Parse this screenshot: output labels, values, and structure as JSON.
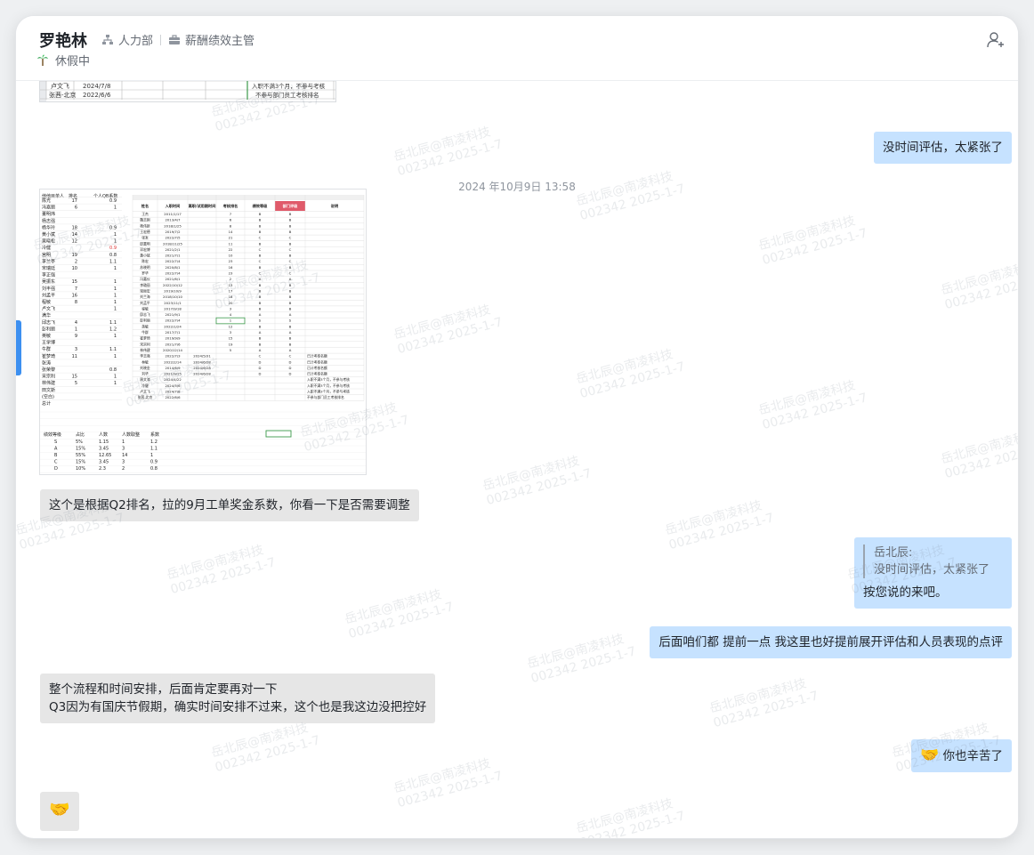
{
  "header": {
    "name": "罗艳林",
    "department": "人力部",
    "title": "薪酬绩效主管",
    "status": "休假中"
  },
  "icons": {
    "department": "org-chart-icon",
    "title": "briefcase-icon",
    "status": "palm-tree-icon",
    "add_user": "add-user-icon"
  },
  "top_snippet": {
    "rows": [
      {
        "name": "卢文飞",
        "date": "2024/7/8",
        "note": "入职不满3个月，不参与考核"
      },
      {
        "name": "张茜-北京",
        "date": "2022/6/6",
        "note": "不参与部门员工考核排名"
      }
    ]
  },
  "messages": {
    "m1": "没时间评估，太紧张了",
    "timestamp": "2024 年10月9日 13:58",
    "m2": "这个是根据Q2排名，拉的9月工单奖金系数，你看一下是否需要调整",
    "reply_quote_author": "岳北辰:",
    "reply_quote_text": "没时间评估，太紧张了",
    "reply_text": "按您说的来吧。",
    "m4": "后面咱们都  提前一点 我这里也好提前展开评估和人员表现的点评",
    "m5_line1": "整个流程和时间安排，后面肯定要再对一下",
    "m5_line2": "Q3因为有国庆节假期，确实时间安排不过来，这个也是我这边没把控好",
    "m6_emoji": "🤝",
    "m6_text": "你也辛苦了",
    "m7_emoji": "🤝"
  },
  "sheet": {
    "left_headers": [
      "他他目单人",
      "排名",
      "个人QB系数"
    ],
    "left_rows": [
      [
        "陈光",
        "17",
        "0.9"
      ],
      [
        "冯嘉丽",
        "6",
        "1"
      ],
      [
        "董明炜",
        "",
        ""
      ],
      [
        "杨志强",
        "",
        ""
      ],
      [
        "杨华玲",
        "18",
        "0.9"
      ],
      [
        "黄小斌",
        "14",
        "1"
      ],
      [
        "吴晓松",
        "12",
        "1"
      ],
      [
        "冷健",
        "",
        "0.9"
      ],
      [
        "宫明",
        "19",
        "0.8"
      ],
      [
        "李兰亭",
        "2",
        "1.1"
      ],
      [
        "宋瑞廷",
        "10",
        "1"
      ],
      [
        "李正强",
        "",
        ""
      ],
      [
        "吴振东",
        "15",
        "1"
      ],
      [
        "刘丰强",
        "7",
        "1"
      ],
      [
        "刘孟平",
        "16",
        "1"
      ],
      [
        "程敏",
        "8",
        "1"
      ],
      [
        "卢文飞",
        "",
        "1"
      ],
      [
        "满华",
        "",
        ""
      ],
      [
        "邱志飞",
        "4",
        "1.1"
      ],
      [
        "彭利丽",
        "1",
        "1.2"
      ],
      [
        "英敏",
        "9",
        "1"
      ],
      [
        "王学博",
        "",
        ""
      ],
      [
        "牛群",
        "3",
        "1.1"
      ],
      [
        "崔梦琦",
        "11",
        "1"
      ],
      [
        "张涛",
        "",
        ""
      ],
      [
        "张荣黎",
        "",
        "0.8"
      ],
      [
        "宋宗利",
        "15",
        "1"
      ],
      [
        "林伟建",
        "5",
        "1"
      ],
      [
        "田文斯",
        "",
        ""
      ],
      [
        "(空白)",
        "",
        ""
      ],
      [
        "总计",
        "",
        ""
      ]
    ],
    "right_headers": [
      "姓名",
      "入职时间",
      "离职/试用期时间",
      "考核排名",
      "绩效等级",
      "部门评级",
      "说明"
    ],
    "right_rows": [
      [
        "王杰",
        "2011/1/17",
        "",
        "7",
        "B",
        "B",
        ""
      ],
      [
        "魏志刚",
        "2013/4/7",
        "",
        "6",
        "B",
        "B",
        ""
      ],
      [
        "杨伟新",
        "2018/1/25",
        "",
        "8",
        "B",
        "B",
        ""
      ],
      [
        "王宏德",
        "2019/7/2",
        "",
        "14",
        "B",
        "B",
        ""
      ],
      [
        "张发",
        "2022/7/5",
        "",
        "21",
        "C",
        "C",
        ""
      ],
      [
        "邱嘉明",
        "2018/11/25",
        "",
        "11",
        "B",
        "B",
        ""
      ],
      [
        "邓宏博",
        "2021/2/1",
        "",
        "22",
        "C",
        "C",
        ""
      ],
      [
        "黄小斌",
        "2021/7/1",
        "",
        "10",
        "B",
        "B",
        ""
      ],
      [
        "陈宏",
        "2022/7/4",
        "",
        "23",
        "C",
        "C",
        ""
      ],
      [
        "苏晓明",
        "2020/8/1",
        "",
        "16",
        "B",
        "B",
        ""
      ],
      [
        "罗华",
        "2022/7/4",
        "",
        "23",
        "C",
        "C",
        ""
      ],
      [
        "冯嘉仪",
        "2021/6/1",
        "",
        "2",
        "A",
        "A",
        ""
      ],
      [
        "李璐丽",
        "2022/10/12",
        "",
        "13",
        "B",
        "B",
        ""
      ],
      [
        "梁振宏",
        "2019/10/9",
        "",
        "17",
        "B",
        "B",
        ""
      ],
      [
        "刘兰海",
        "2018/10/10",
        "",
        "18",
        "B",
        "B",
        ""
      ],
      [
        "刘孟平",
        "2023/11/1",
        "",
        "20",
        "B",
        "B",
        ""
      ],
      [
        "程敏",
        "2017/9/18",
        "",
        "3",
        "B",
        "B",
        ""
      ],
      [
        "邱志飞",
        "2021/9/1",
        "",
        "4",
        "A",
        "A",
        ""
      ],
      [
        "彭利丽",
        "2022/7/4",
        "",
        "1",
        "S",
        "S",
        ""
      ],
      [
        "英敏",
        "2022/1/24",
        "",
        "12",
        "B",
        "B",
        ""
      ],
      [
        "牛群",
        "2017/7/1",
        "",
        "3",
        "A",
        "A",
        ""
      ],
      [
        "崔梦琦",
        "2019/9/9",
        "",
        "15",
        "B",
        "B",
        ""
      ],
      [
        "宋宗利",
        "2021/7/6",
        "",
        "19",
        "B",
        "B",
        ""
      ],
      [
        "林伟建",
        "2020/12/14",
        "",
        "5",
        "A",
        "A",
        ""
      ],
      [
        "李志强",
        "2022/7/3",
        "2024/5/31",
        "",
        "C",
        "C",
        "已计考核名额"
      ],
      [
        "林敏",
        "2022/2/14",
        "2024/6/28",
        "",
        "D",
        "D",
        "已计考核名额"
      ],
      [
        "刘晓金",
        "2014/6/9",
        "2024/6/28",
        "",
        "D",
        "D",
        "已计考核名额"
      ],
      [
        "刘华",
        "2021/9/15",
        "2024/6/28",
        "",
        "D",
        "D",
        "已计考核名额"
      ],
      [
        "周文涛",
        "2024/4/22",
        "",
        "",
        "",
        "",
        "入职不满3个月，不参与考核"
      ],
      [
        "冷健",
        "2024/5/6",
        "",
        "",
        "",
        "",
        "入职不满3个月，不参与考核"
      ],
      [
        "卢文飞",
        "2024/7/8",
        "",
        "",
        "",
        "",
        "入职不满3个月，不参与考核"
      ],
      [
        "张茜-北京",
        "2022/6/6",
        "",
        "",
        "",
        "",
        "不参与部门员工考核排名"
      ]
    ],
    "bottom_headers": [
      "绩效等级",
      "占比",
      "人数",
      "人数取整",
      "系数"
    ],
    "bottom_rows": [
      [
        "S",
        "5%",
        "1.15",
        "1",
        "1.2"
      ],
      [
        "A",
        "15%",
        "3.45",
        "3",
        "1.1"
      ],
      [
        "B",
        "55%",
        "12.65",
        "14",
        "1"
      ],
      [
        "C",
        "15%",
        "3.45",
        "3",
        "0.9"
      ],
      [
        "D",
        "10%",
        "2.3",
        "2",
        "0.8"
      ]
    ]
  },
  "watermark": {
    "line1": "岳北辰@南凌科技",
    "line2": "002342 2025-1-7"
  },
  "colors": {
    "bubble_right": "#c6e2ff",
    "bubble_left": "#e6e6e6",
    "accent": "#3c8ff0",
    "rank_header": "#e05a6a"
  }
}
